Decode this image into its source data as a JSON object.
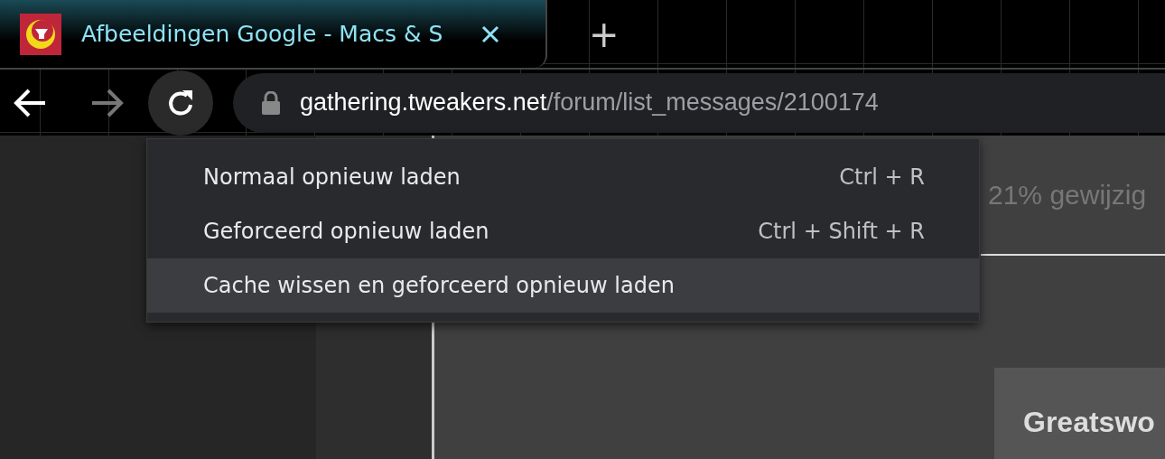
{
  "tabs": [
    {
      "title": "Afbeeldingen Google - Macs & S",
      "selected": true
    }
  ],
  "new_tab": {
    "label": "+"
  },
  "toolbar": {
    "back_disabled": false,
    "forward_disabled": true,
    "reload_hovered": true
  },
  "address_bar": {
    "domain": "gathering.tweakers.net",
    "path": "/forum/list_messages/2100174"
  },
  "reload_menu": {
    "items": [
      {
        "label": "Normaal opnieuw laden",
        "shortcut": "Ctrl + R",
        "selected": false
      },
      {
        "label": "Geforceerd opnieuw laden",
        "shortcut": "Ctrl + Shift + R",
        "selected": false
      },
      {
        "label": "Cache wissen en geforceerd opnieuw laden",
        "selected": true
      }
    ]
  },
  "page": {
    "change_text": "21% gewijzig",
    "card_title": "Greatswo"
  }
}
